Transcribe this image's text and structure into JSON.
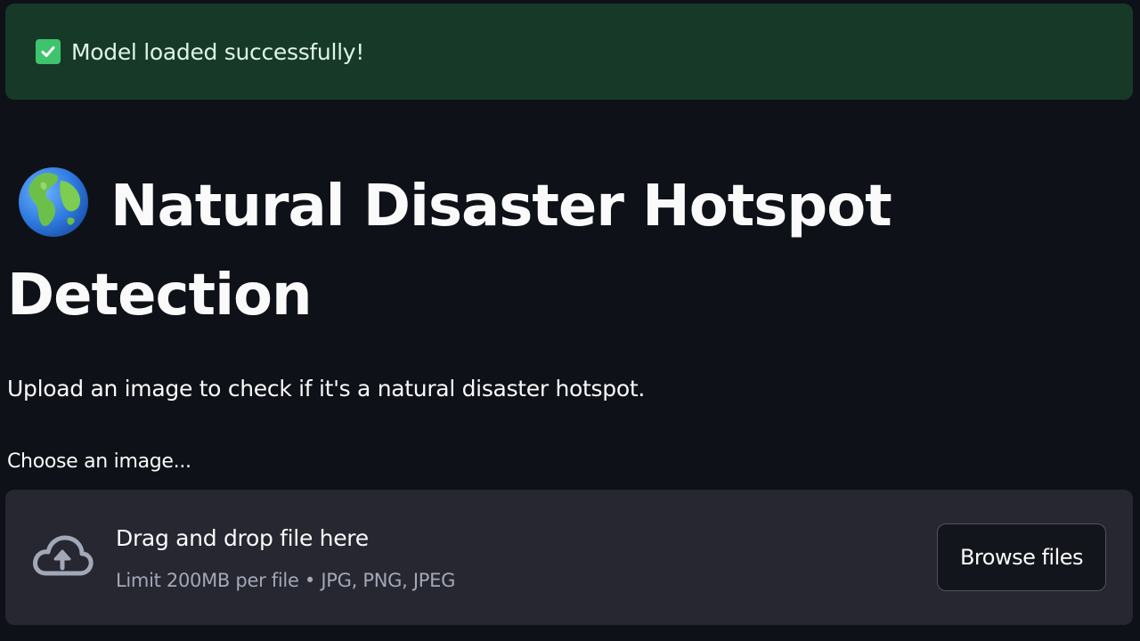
{
  "alert": {
    "message": "Model loaded successfully!",
    "icon": "check-box-icon",
    "color": "#173928"
  },
  "header": {
    "icon": "globe-icon",
    "title": "Natural Disaster Hotspot Detection"
  },
  "main": {
    "description": "Upload an image to check if it's a natural disaster hotspot."
  },
  "uploader": {
    "label": "Choose an image...",
    "icon": "cloud-upload-icon",
    "drop_text": "Drag and drop file here",
    "limit_text": "Limit 200MB per file • JPG, PNG, JPEG",
    "browse_label": "Browse files"
  },
  "theme": {
    "background": "#0e1117",
    "dropzone": "#262730",
    "accent": "#3ec46d"
  }
}
